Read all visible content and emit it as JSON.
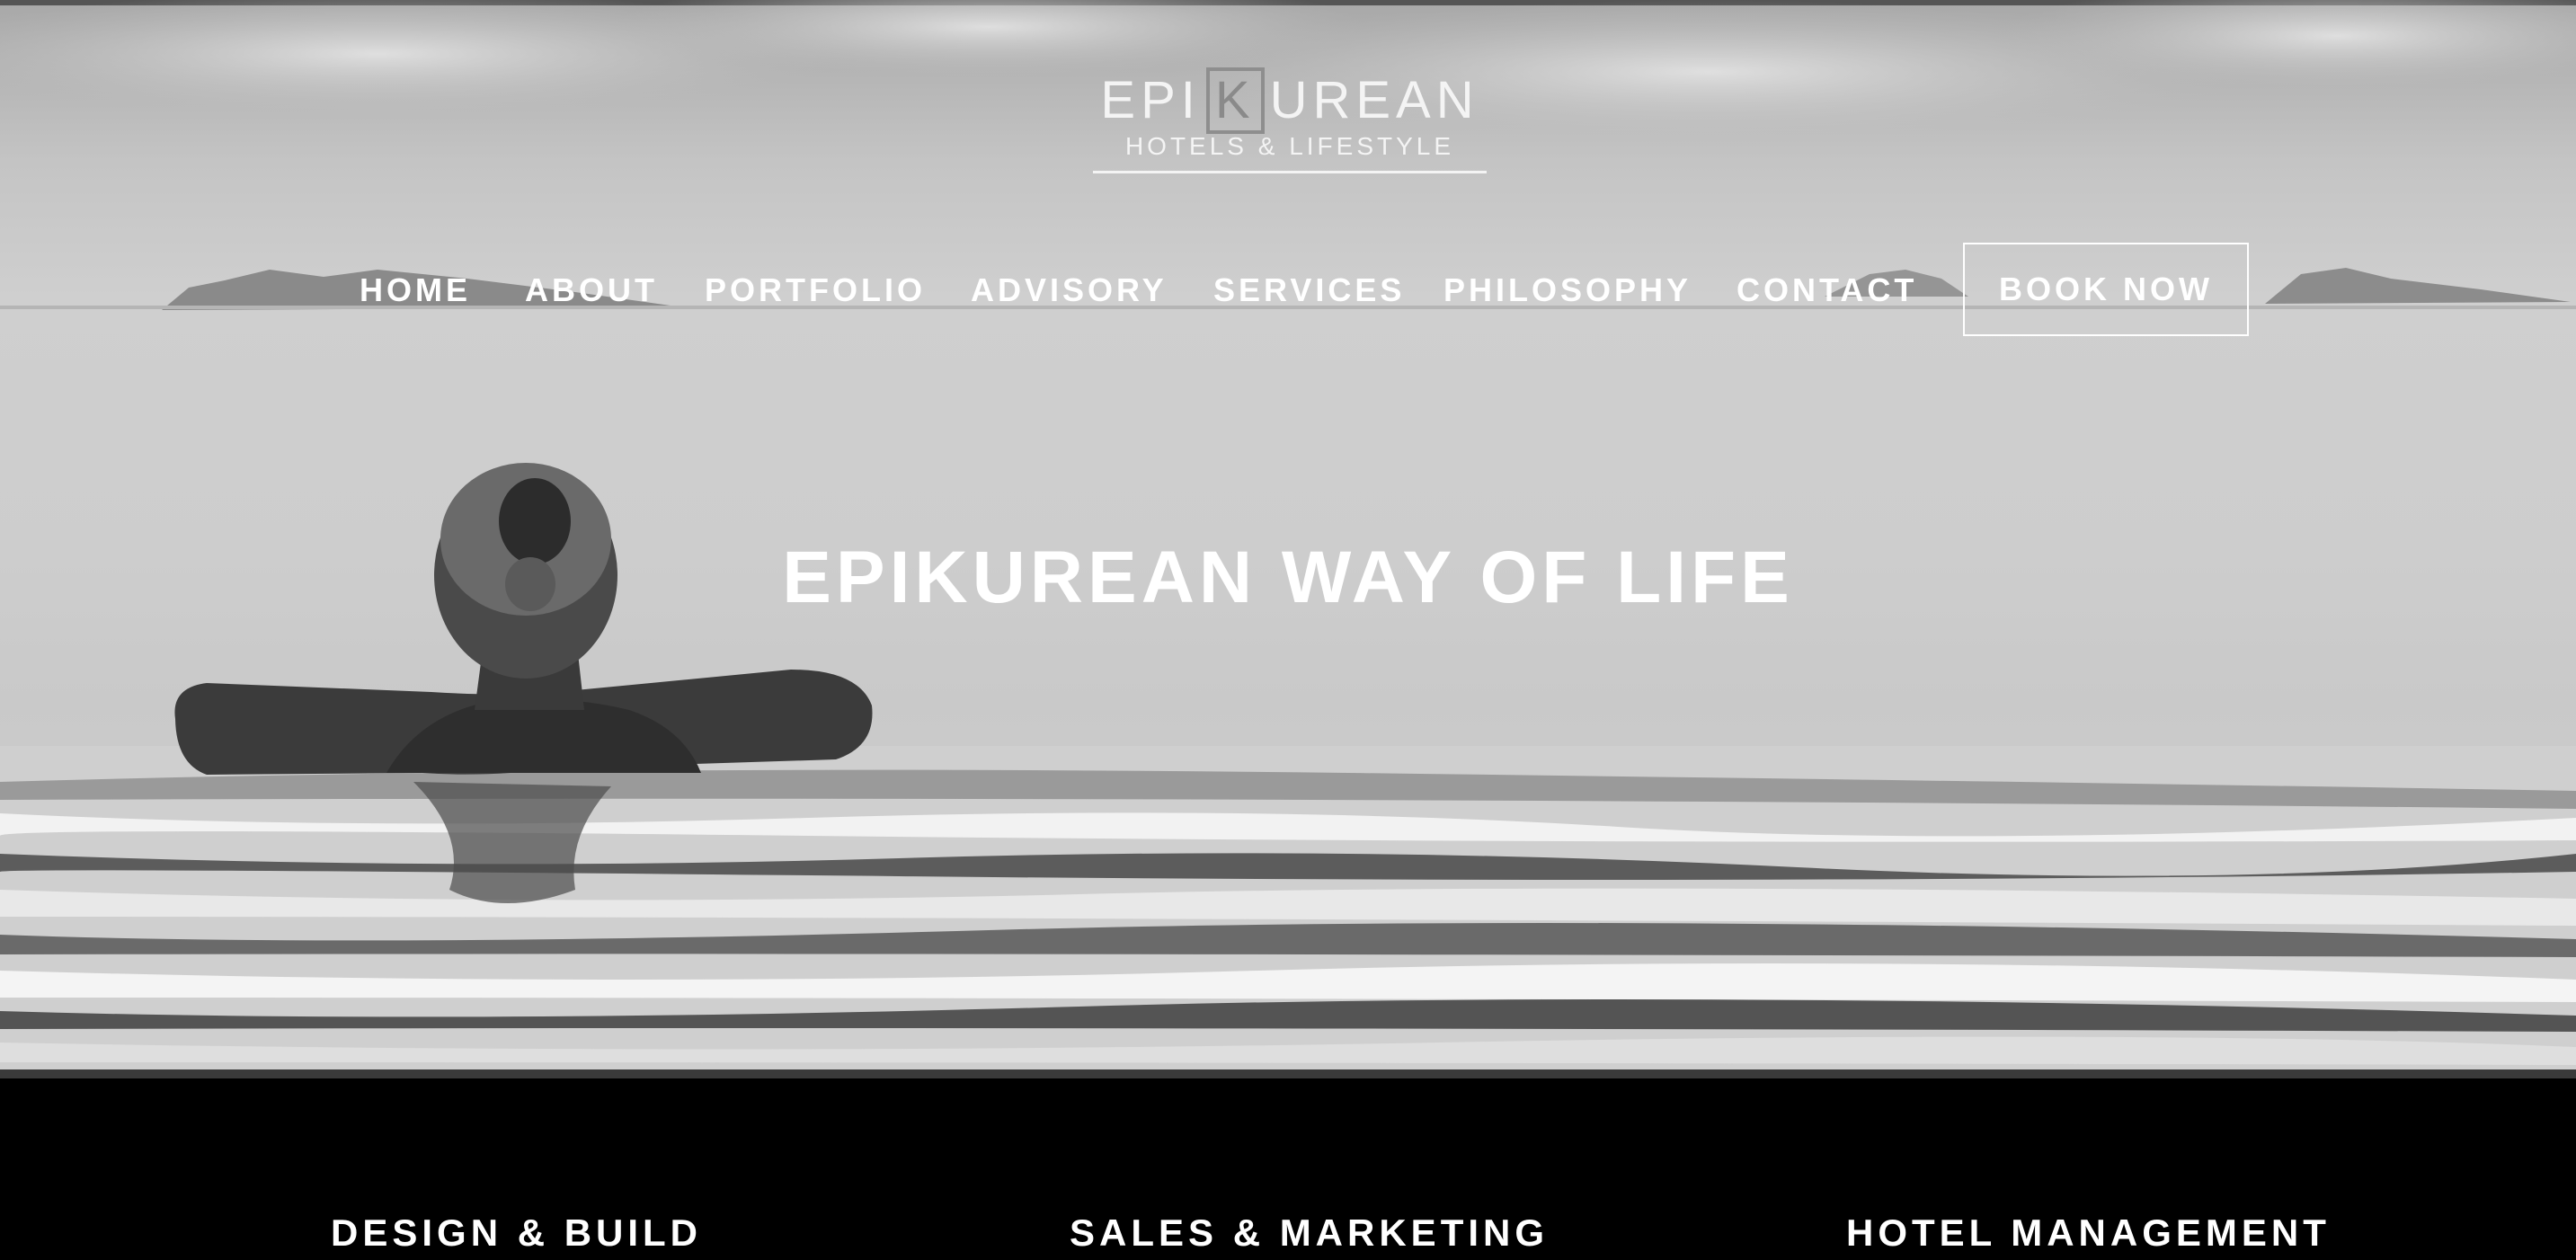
{
  "logo": {
    "left": "EPI",
    "k": "K",
    "right": "UREAN",
    "subtitle": "HOTELS & LIFESTYLE"
  },
  "nav": {
    "items": [
      {
        "label": "HOME"
      },
      {
        "label": "ABOUT"
      },
      {
        "label": "PORTFOLIO"
      },
      {
        "label": "ADVISORY"
      },
      {
        "label": "SERVICES"
      },
      {
        "label": "PHILOSOPHY"
      },
      {
        "label": "CONTACT"
      }
    ],
    "book_label": "BOOK NOW"
  },
  "hero": {
    "title": "EPIKUREAN WAY OF LIFE"
  },
  "features": [
    {
      "label": "DESIGN & BUILD"
    },
    {
      "label": "SALES & MARKETING"
    },
    {
      "label": "HOTEL MANAGEMENT"
    }
  ]
}
